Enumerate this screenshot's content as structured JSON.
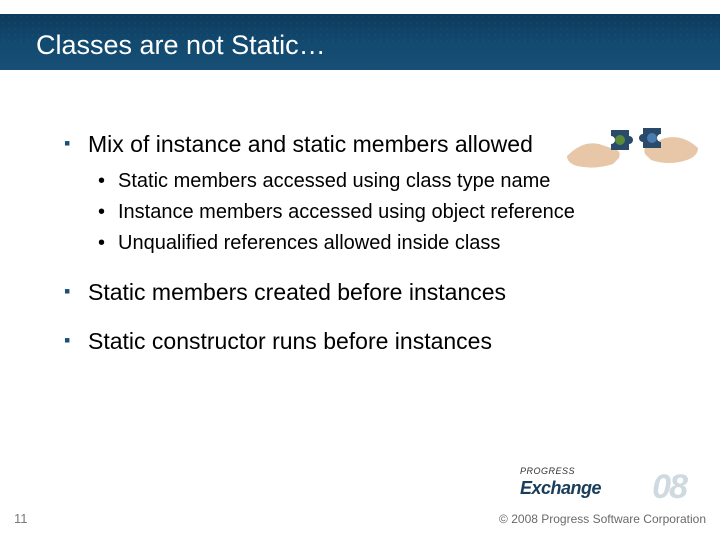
{
  "title": "Classes are not Static…",
  "bullets": {
    "b1": "Mix of instance and static members allowed",
    "b1_sub": {
      "s1": "Static members accessed using class type name",
      "s2": "Instance members accessed using object reference",
      "s3": "Unqualified references allowed inside class"
    },
    "b2": "Static members created before instances",
    "b3": "Static constructor runs before instances"
  },
  "page_number": "11",
  "copyright": "© 2008 Progress Software Corporation",
  "brand": {
    "small": "PROGRESS",
    "main": "Exchange",
    "year": "08"
  }
}
